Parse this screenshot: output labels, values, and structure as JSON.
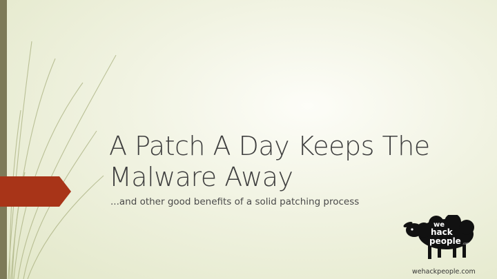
{
  "slide": {
    "title_line1": "A Patch A Day Keeps The",
    "title_line2": "Malware Away",
    "subtitle": "...and other good benefits of a solid patching process",
    "footer_url": "wehackpeople.com"
  },
  "logo": {
    "line1": "we",
    "line2": "hack",
    "line3": "people",
    "suffix": ".com",
    "icon": "sheep-icon"
  },
  "colors": {
    "accent": "#a83418",
    "left_bar": "#7d7a58",
    "title_text": "#3f3f3f",
    "background": "#f1f3e2"
  }
}
